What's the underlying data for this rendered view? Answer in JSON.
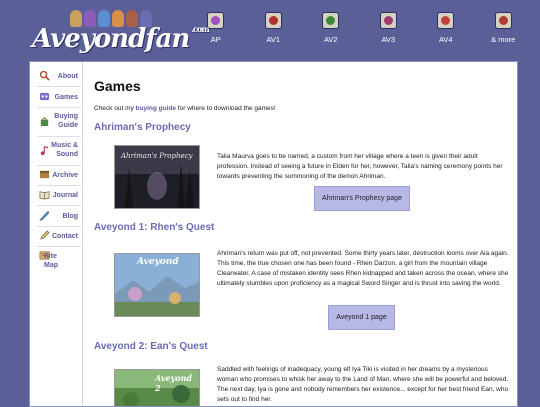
{
  "header": {
    "logo_text": "Aveyondfan",
    "logo_suffix": ".com",
    "nav": [
      {
        "label": "AP",
        "icon": "ap-game-icon",
        "color": "#a04ec0"
      },
      {
        "label": "AV1",
        "icon": "av1-game-icon",
        "color": "#b03030"
      },
      {
        "label": "AV2",
        "icon": "av2-game-icon",
        "color": "#3a8a3a"
      },
      {
        "label": "AV3",
        "icon": "av3-game-icon",
        "color": "#a03a6a"
      },
      {
        "label": "AV4",
        "icon": "av4-game-icon",
        "color": "#c04040"
      },
      {
        "label": "& more",
        "icon": "more-games-icon",
        "color": "#b03a3a"
      }
    ]
  },
  "sidebar": {
    "items": [
      {
        "label": "About",
        "icon": "magnifier-icon"
      },
      {
        "label": "Games",
        "icon": "games-icon"
      },
      {
        "label": "Buying Guide",
        "icon": "shopping-bag-icon"
      },
      {
        "label": "Music & Sound",
        "icon": "music-note-icon"
      },
      {
        "label": "Archive",
        "icon": "archive-box-icon"
      },
      {
        "label": "Journal",
        "icon": "journal-book-icon"
      },
      {
        "label": "Blog",
        "icon": "quill-pen-icon"
      },
      {
        "label": "Contact",
        "icon": "contact-pencil-icon"
      },
      {
        "label": "Site Map",
        "icon": "site-map-icon"
      }
    ]
  },
  "main": {
    "title": "Games",
    "intro": {
      "before": "Check out my ",
      "link": "buying guide",
      "after": " for where to download the games!"
    },
    "games": [
      {
        "title": "Ahriman's Prophecy",
        "thumb_title": "Ahriman's Prophecy",
        "desc": "Talia Maurva goes to be named, a custom from her village where a teen is given their adult profession. Instead of seeing a future in Elden for her, however, Talia's naming ceremony points her towards preventing the summoning of the demon Ahriman.",
        "button": "Ahriman's Prophecy page"
      },
      {
        "title": "Aveyond 1: Rhen's Quest",
        "thumb_title": "Aveyond",
        "desc": "Ahriman's return was put off, not prevented. Some thirty years later, destruction looms over Aia again. This time, the true chosen one has been found - Rhen Darzon, a girl from the mountain village Clearwater. A case of mistaken identity sees Rhen kidnapped and taken across the ocean, where she ultimately stumbles upon proficiency as a magical Sword Singer and is thrust into saving the world.",
        "button": "Aveyond 1 page"
      },
      {
        "title": "Aveyond 2: Ean's Quest",
        "thumb_title": "Aveyond 2",
        "desc": "Saddled with feelings of inadequacy, young elf Iya Tiki is visited in her dreams by a mysterious woman who promises to whisk her away to the Land of Man, where she will be powerful and beloved. The next day, Iya is gone and nobody remembers her existence... except for her best friend Ean, who sets out to find her."
      }
    ]
  }
}
